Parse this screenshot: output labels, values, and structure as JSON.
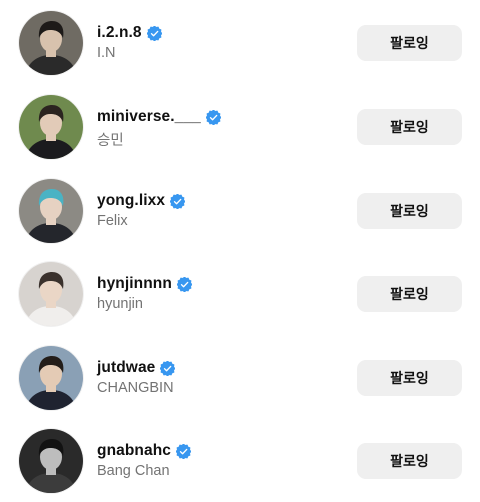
{
  "following": [
    {
      "username": "i.2.n.8",
      "full_name": "I.N",
      "verified": true,
      "button_label": "팔로잉",
      "avatar": {
        "bg": "#6f6b63",
        "face": "#d8c2ad",
        "hair": "#1d1a18",
        "cloth": "#2a2a2a"
      }
    },
    {
      "username": "miniverse.___",
      "full_name": "승민",
      "verified": true,
      "button_label": "팔로잉",
      "avatar": {
        "bg": "#6f8a4e",
        "face": "#e2cbb8",
        "hair": "#2b2420",
        "cloth": "#1b1b1e"
      }
    },
    {
      "username": "yong.lixx",
      "full_name": "Felix",
      "verified": true,
      "button_label": "팔로잉",
      "avatar": {
        "bg": "#8c8a84",
        "face": "#e6d2c2",
        "hair": "#4ab3c4",
        "cloth": "#24262c"
      }
    },
    {
      "username": "hynjinnnn",
      "full_name": "hyunjin",
      "verified": true,
      "button_label": "팔로잉",
      "avatar": {
        "bg": "#d7d3cf",
        "face": "#ead6c6",
        "hair": "#3a312c",
        "cloth": "#f0eeec"
      }
    },
    {
      "username": "jutdwae",
      "full_name": "CHANGBIN",
      "verified": true,
      "button_label": "팔로잉",
      "avatar": {
        "bg": "#8aa0b5",
        "face": "#e4cbb5",
        "hair": "#231d19",
        "cloth": "#1f2330"
      }
    },
    {
      "username": "gnabnahc",
      "full_name": "Bang Chan",
      "verified": true,
      "button_label": "팔로잉",
      "avatar": {
        "bg": "#2a2a2a",
        "face": "#bdbdbd",
        "hair": "#121212",
        "cloth": "#3c3c3c"
      }
    }
  ],
  "colors": {
    "verified_badge": "#3897f0",
    "secondary_text": "#737373",
    "button_bg": "#efefef"
  }
}
